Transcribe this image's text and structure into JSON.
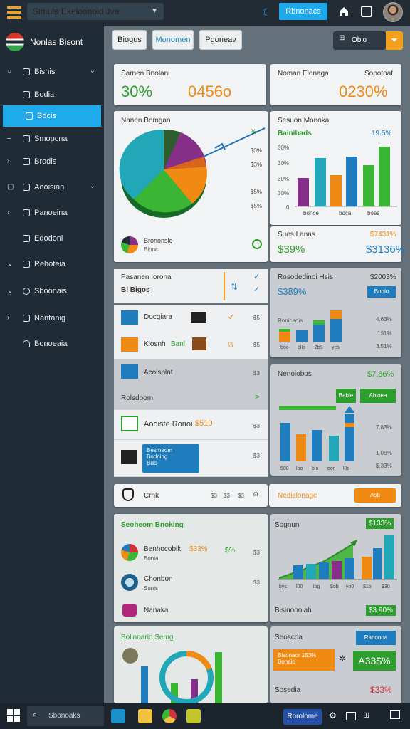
{
  "window_title": "Simula Ekeloonoid Jva",
  "top": {
    "action_button": "Rbnonacs"
  },
  "app_name": "Nonlas Bisont",
  "nav": [
    {
      "label": "Bisnis"
    },
    {
      "label": "Bodia"
    },
    {
      "label": "Bdcis"
    },
    {
      "label": "Smopcna"
    },
    {
      "label": "Brodis"
    },
    {
      "label": "Aooisian"
    },
    {
      "label": "Panoeina"
    },
    {
      "label": "Edodoni"
    },
    {
      "label": "Rehoteia"
    },
    {
      "label": "Sboonais"
    },
    {
      "label": "Nantanig"
    },
    {
      "label": "Bonoeaia"
    }
  ],
  "tabs": [
    "Biogus",
    "Monomen",
    "Pgoneav"
  ],
  "tools": {
    "label": "Oblo"
  },
  "summary": {
    "label": "Sarnen Bnolani",
    "value1": "30%",
    "value2": "0456o",
    "label2": "Noman Elonaga",
    "label3": "Sopotoat",
    "value3": "0230%"
  },
  "pie_panel": {
    "title": "Nanen Bomgan",
    "pct": [
      "$3%",
      "$3%",
      "$5%",
      "$5%"
    ],
    "foot_label": "Brononsle",
    "foot_sub": "Bionc"
  },
  "bar_panel": {
    "title": "Sesuon Monoka",
    "subtitle": "Bainibads",
    "pct": "19.5%",
    "ylabels": [
      "30%",
      "30%",
      "30%",
      "30%",
      "0"
    ],
    "xlabels": [
      "bonce",
      "boca",
      "boes"
    ],
    "foot_title": "Sues Lanas",
    "foot_val": "$7431%",
    "val_a": "$39%",
    "val_b": "$3136%"
  },
  "task_panel": {
    "title": "Pasanen Iorona",
    "sub": "Bl Bigos"
  },
  "rows": [
    {
      "label": "Docgiara",
      "num": "$5"
    },
    {
      "label": "Klosnh",
      "tag": "Banl",
      "num": "$5"
    },
    {
      "label": "Acoisplat",
      "num": "$3"
    },
    {
      "label": "Rolsdoom",
      "num": ">"
    },
    {
      "label": "Aooiste Ronoi",
      "value": "$510",
      "num": "$3"
    },
    {
      "label": "Besmeom",
      "sub1": "Bodning",
      "sub2": "Bilis",
      "num": "$3"
    }
  ],
  "mid_panel": {
    "title": "Rosodedinoi Hsis",
    "val": "$2003%",
    "value": "$389%",
    "btn": "Bobio",
    "line1": "Roniceois",
    "p1": "4.63%",
    "p2": "1$1%",
    "p3": "3.51%",
    "xl": [
      "boo",
      "bllo",
      "2b9",
      "yes"
    ]
  },
  "bottom_right": {
    "title": "Nenoiobos",
    "val": "$7.86%",
    "btn1": "Babie",
    "btn2": "Abioea",
    "p1": "7.83%",
    "p2": "1.06%",
    "p3": "$.33%",
    "xl": [
      "500",
      "loo",
      "bio",
      "oor",
      "l0o"
    ]
  },
  "strip": {
    "label": "Crnk",
    "nums": [
      "$3",
      "$3",
      "$3"
    ],
    "right_label": "Nedislonage",
    "btn": "Asb"
  },
  "bottom_left": {
    "title": "Seoheom Bnoking",
    "rows": [
      {
        "label": "Benhocobik",
        "pct": "$33%",
        "pct2": "$%",
        "num": "$3",
        "sub": "Bonia"
      },
      {
        "label": "Chonbon",
        "sub": "Sunis",
        "num": "$3"
      },
      {
        "label": "Nanaka",
        "num": ""
      }
    ],
    "title2": "Bolinoario Semg"
  },
  "bottom_mid": {
    "title": "Sognun",
    "val": "$133%",
    "xl": [
      "bys",
      "l00",
      "lbg",
      "$ob",
      "yo0",
      "$1b",
      "$30"
    ],
    "foot": "Bisinooolah",
    "foot_val": "$3.90%"
  },
  "bottom_card": {
    "title": "Seoscoa",
    "btn": "Rahonoa",
    "orange_box": "Bisonaor 153%",
    "orange_sub": "Bonaio",
    "val": "A33$%",
    "foot": "Sosedia",
    "foot_val": "$33%"
  },
  "taskbar": {
    "search": "Sbonoaks",
    "button": "Rbrolome"
  },
  "colors": {
    "teal": "#22a7b8",
    "green": "#3bb534",
    "orange": "#f08a12",
    "purple": "#862f88",
    "blue": "#1f7dbd"
  }
}
